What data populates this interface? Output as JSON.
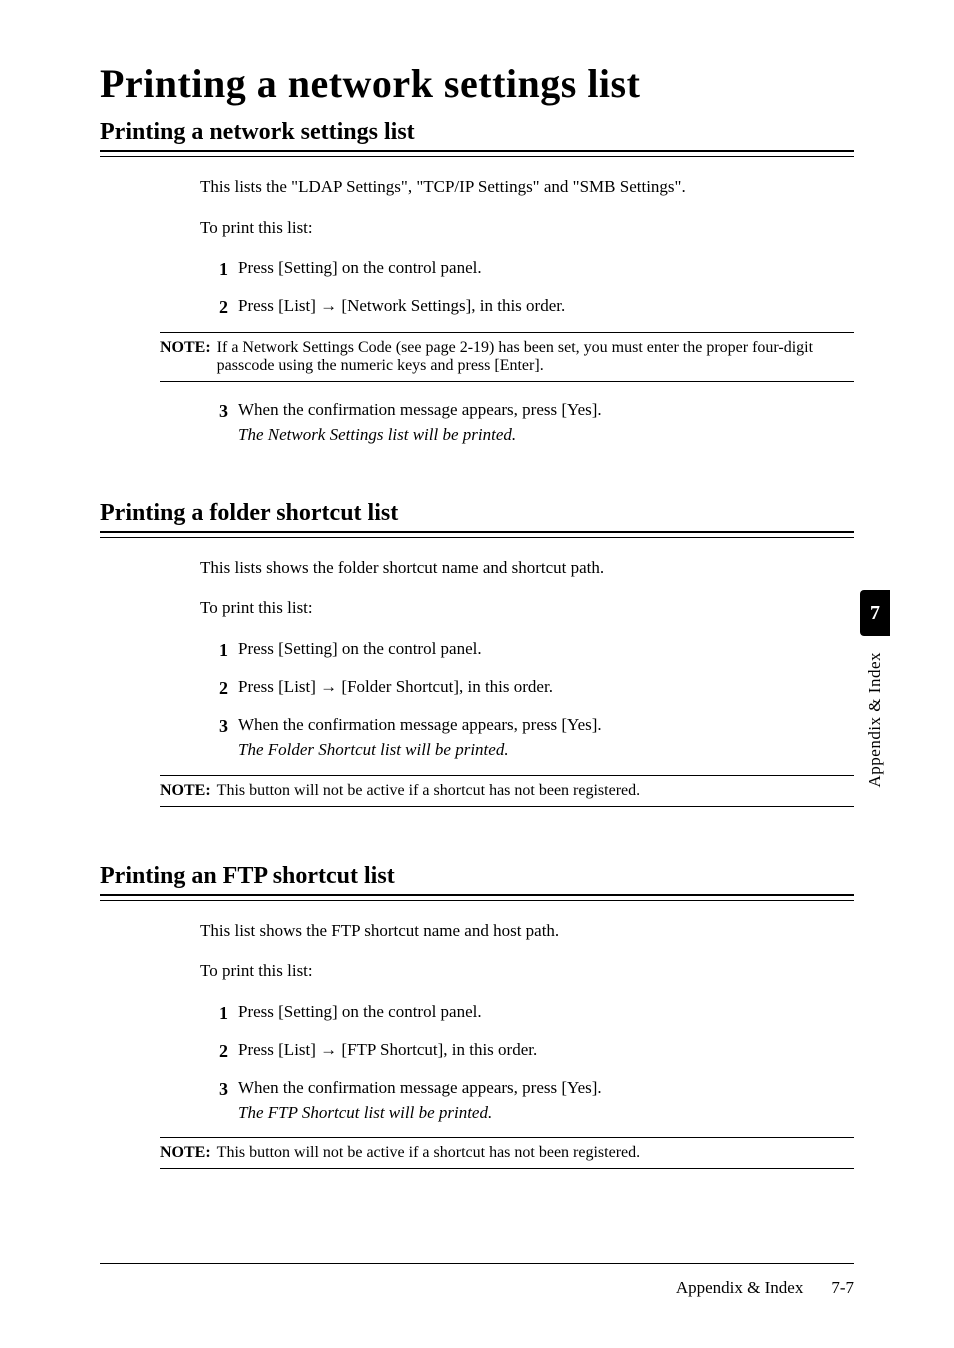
{
  "title": "Printing a network settings list",
  "tab": {
    "number": "7",
    "label": "Appendix & Index"
  },
  "sections": {
    "network": {
      "heading": "Printing a network settings list",
      "intro": "This lists the \"LDAP Settings\", \"TCP/IP Settings\" and \"SMB Settings\".",
      "to_print": "To print this list:",
      "steps": {
        "s1_num": "1",
        "s1_txt": "Press [Setting] on the control panel.",
        "s2_num": "2",
        "s2_txt": "Press [List] → [Network Settings], in this order.",
        "s3_num": "3",
        "s3_txt": "When the confirmation message appears, press [Yes].",
        "s3_result": "The Network Settings list will be printed."
      },
      "note_label": "NOTE:",
      "note_text": "If a Network Settings Code (see page 2-19) has been set, you must enter the proper four-digit passcode using the numeric keys and press [Enter]."
    },
    "folder": {
      "heading": "Printing a folder shortcut list",
      "intro": "This lists shows the folder shortcut name and shortcut path.",
      "to_print": "To print this list:",
      "steps": {
        "s1_num": "1",
        "s1_txt": "Press [Setting] on the control panel.",
        "s2_num": "2",
        "s2_txt": "Press [List] → [Folder Shortcut], in this order.",
        "s3_num": "3",
        "s3_txt": "When the confirmation message appears, press [Yes].",
        "s3_result": "The Folder Shortcut list will be printed."
      },
      "note_label": "NOTE:",
      "note_text": "This button will not be active if a shortcut has not been registered."
    },
    "ftp": {
      "heading": "Printing an FTP shortcut list",
      "intro": "This list shows the FTP shortcut name and host path.",
      "to_print": "To print this list:",
      "steps": {
        "s1_num": "1",
        "s1_txt": "Press [Setting] on the control panel.",
        "s2_num": "2",
        "s2_txt": "Press [List] → [FTP Shortcut], in this order.",
        "s3_num": "3",
        "s3_txt": "When the confirmation message appears, press [Yes].",
        "s3_result": "The FTP Shortcut list will be printed."
      },
      "note_label": "NOTE:",
      "note_text": "This button will not be active if a shortcut has not been registered."
    }
  },
  "footer": {
    "section": "Appendix & Index",
    "page": "7-7"
  }
}
